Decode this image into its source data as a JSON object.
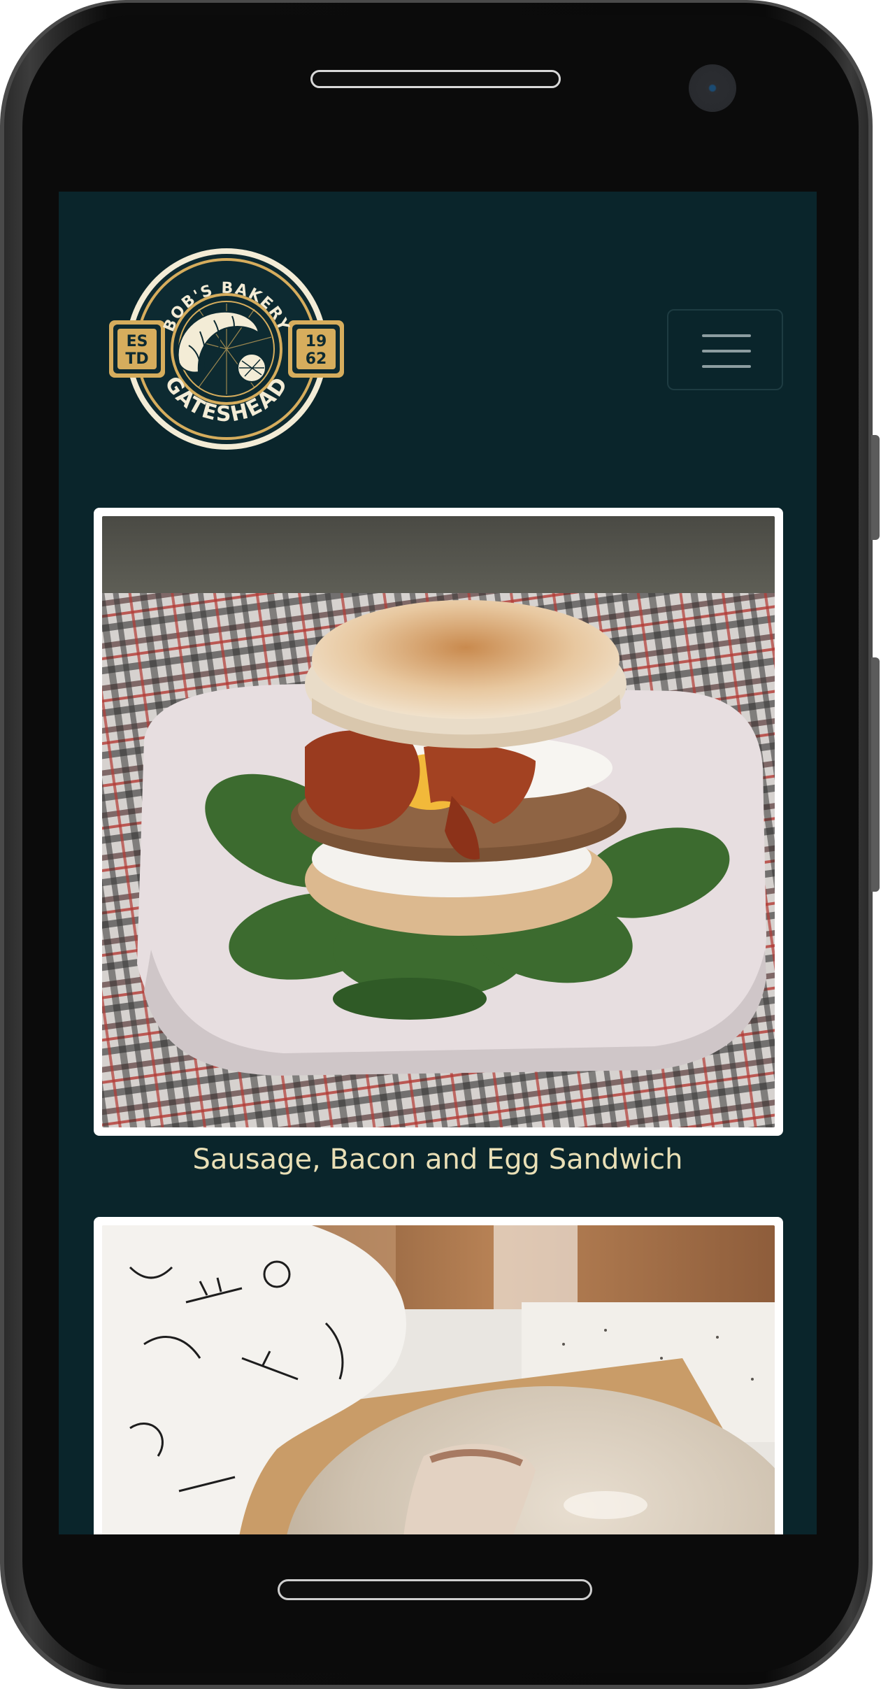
{
  "header": {
    "logo": {
      "top_text": "BOB'S BAKERY",
      "bottom_text": "GATESHEAD",
      "left_badge": [
        "ES",
        "TD"
      ],
      "right_badge": [
        "19",
        "62"
      ],
      "icon": "croissant-icon"
    },
    "menu_icon": "hamburger-icon"
  },
  "gallery": {
    "items": [
      {
        "image": "sausage-bacon-egg-sandwich-photo",
        "caption": "Sausage, Bacon and Egg Sandwich"
      },
      {
        "image": "sourdough-loaf-photo",
        "caption": ""
      }
    ]
  },
  "colors": {
    "page_background": "#0a252b",
    "caption_text": "#e9dfb6",
    "logo_gold": "#d6ad5d",
    "logo_navy": "#0d2a31",
    "logo_cream": "#f3ecd6",
    "phone_bezel": "#0b0b0b"
  }
}
